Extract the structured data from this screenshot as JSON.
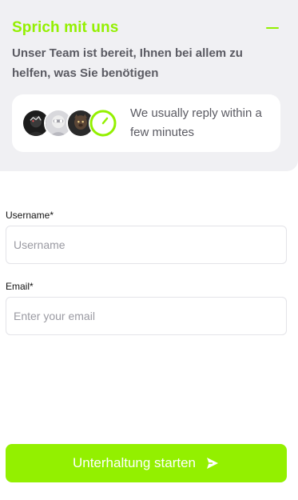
{
  "header": {
    "title": "Sprich mit uns",
    "subtitle": "Unser Team ist bereit, Ihnen bei allem zu helfen, was Sie benötigen",
    "minimize_icon": "minus-icon"
  },
  "reply_card": {
    "text": "We usually reply within a few minutes",
    "clock_icon": "clock-icon"
  },
  "form": {
    "username": {
      "label": "Username",
      "required_mark": "*",
      "placeholder": "Username",
      "value": ""
    },
    "email": {
      "label": "Email",
      "required_mark": "*",
      "placeholder": "Enter your email",
      "value": ""
    },
    "submit": {
      "label": "Unterhaltung starten",
      "icon": "send-icon"
    }
  },
  "colors": {
    "accent": "#93f000",
    "panel_bg": "#f0f0f3",
    "text_muted": "#5a5a62"
  }
}
